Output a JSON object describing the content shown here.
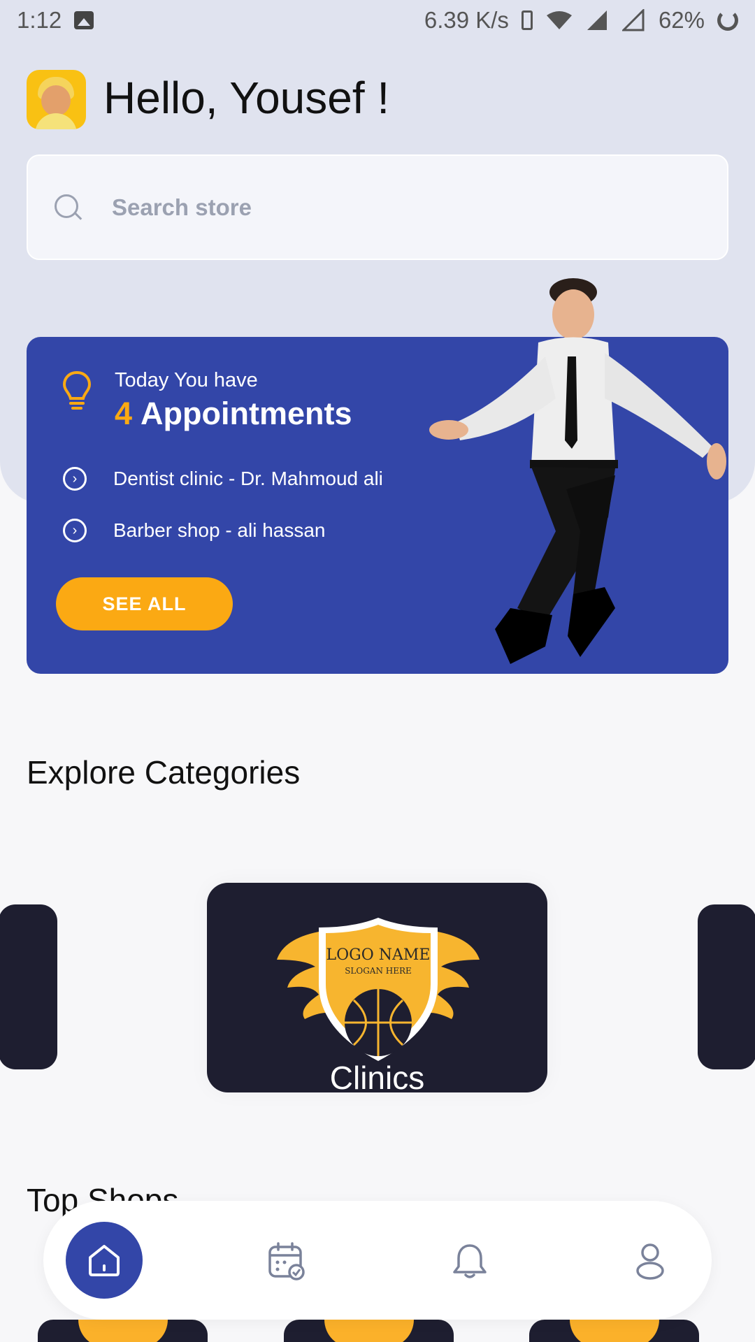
{
  "status_bar": {
    "time": "1:12",
    "speed": "6.39 K/s",
    "battery": "62%"
  },
  "header": {
    "greeting": "Hello, Yousef !"
  },
  "search": {
    "placeholder": "Search store"
  },
  "appointments": {
    "intro": "Today You have",
    "count": "4",
    "title": "Appointments",
    "items": [
      {
        "label": "Dentist clinic - Dr. Mahmoud ali"
      },
      {
        "label": "Barber shop - ali hassan"
      }
    ],
    "button_label": "SEE ALL"
  },
  "categories": {
    "title": "Explore Categories",
    "items": [
      {
        "label": "Clinics",
        "logo_name": "LOGO NAME",
        "logo_slogan": "SLOGAN HERE"
      }
    ]
  },
  "top_shops": {
    "title": "Top Shops"
  },
  "nav": {
    "items": [
      "home-icon",
      "calendar-icon",
      "bell-icon",
      "profile-icon"
    ]
  },
  "colors": {
    "primary": "#3346a8",
    "accent": "#fba913",
    "card_dark": "#1e1e30",
    "hero_bg": "#e0e3ef"
  }
}
